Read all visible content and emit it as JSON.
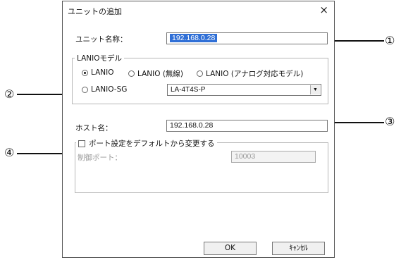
{
  "dialog": {
    "title": "ユニットの追加",
    "close_glyph": "×"
  },
  "unit_name": {
    "label": "ユニット名称：",
    "value": "192.168.0.28"
  },
  "model_group": {
    "legend": "LANIOモデル",
    "radios": [
      {
        "label": "LANIO",
        "checked": true
      },
      {
        "label": "LANIO (無線)",
        "checked": false
      },
      {
        "label": "LANIO (アナログ対応モデル)",
        "checked": false
      },
      {
        "label": "LANIO-SG",
        "checked": false
      }
    ],
    "combo_value": "LA-4T4S-P",
    "combo_arrow": "▼"
  },
  "host": {
    "label": "ホスト名：",
    "value": "192.168.0.28"
  },
  "port_group": {
    "checkbox_label": "ポート設定をデフォルトから変更する",
    "checked": false,
    "control_port_label": "制御ポート：",
    "control_port_value": "10003"
  },
  "buttons": {
    "ok": "OK",
    "cancel": "ｷｬﾝｾﾙ"
  },
  "callouts": {
    "c1": "①",
    "c2": "②",
    "c3": "③",
    "c4": "④"
  }
}
